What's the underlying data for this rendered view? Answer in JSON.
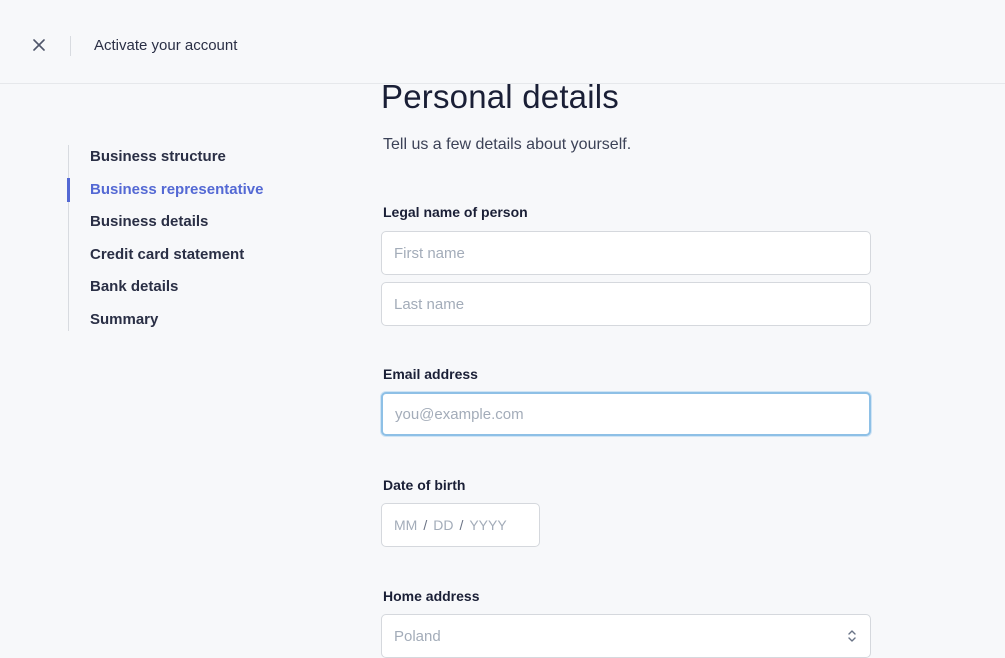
{
  "header": {
    "title": "Activate your account",
    "close_icon": "close-icon"
  },
  "sidebar": {
    "items": [
      {
        "label": "Business structure",
        "active": false
      },
      {
        "label": "Business representative",
        "active": true
      },
      {
        "label": "Business details",
        "active": false
      },
      {
        "label": "Credit card statement",
        "active": false
      },
      {
        "label": "Bank details",
        "active": false
      },
      {
        "label": "Summary",
        "active": false
      }
    ]
  },
  "form": {
    "title": "Personal details",
    "subtitle": "Tell us a few details about yourself.",
    "legal_name": {
      "label": "Legal name of person",
      "first_placeholder": "First name",
      "last_placeholder": "Last name"
    },
    "email": {
      "label": "Email address",
      "placeholder": "you@example.com"
    },
    "dob": {
      "label": "Date of birth",
      "month": "MM",
      "day": "DD",
      "year": "YYYY",
      "separator": "/"
    },
    "address": {
      "label": "Home address",
      "country": "Poland"
    }
  },
  "colors": {
    "accent": "#5469d4",
    "focus_ring": "#8ec0e6",
    "placeholder": "#a3acb9"
  }
}
